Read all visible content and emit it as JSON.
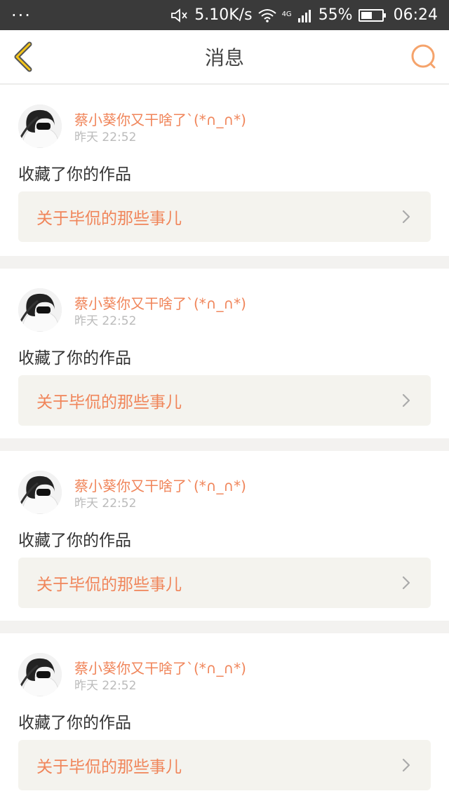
{
  "status_bar": {
    "left_dots": "···",
    "network_speed": "5.10K/s",
    "network_type": "4G",
    "battery_text": "55%",
    "battery_level": 0.55,
    "time": "06:24"
  },
  "header": {
    "title": "消息",
    "accent_color": "#f5a623"
  },
  "messages": [
    {
      "user": "蔡小葵你又干啥了`(*∩_∩*)",
      "time": "昨天 22:52",
      "action": "收藏了你的作品",
      "work_title": "关于毕侃的那些事儿"
    },
    {
      "user": "蔡小葵你又干啥了`(*∩_∩*)",
      "time": "昨天 22:52",
      "action": "收藏了你的作品",
      "work_title": "关于毕侃的那些事儿"
    },
    {
      "user": "蔡小葵你又干啥了`(*∩_∩*)",
      "time": "昨天 22:52",
      "action": "收藏了你的作品",
      "work_title": "关于毕侃的那些事儿"
    },
    {
      "user": "蔡小葵你又干啥了`(*∩_∩*)",
      "time": "昨天 22:52",
      "action": "收藏了你的作品",
      "work_title": "关于毕侃的那些事儿"
    }
  ]
}
